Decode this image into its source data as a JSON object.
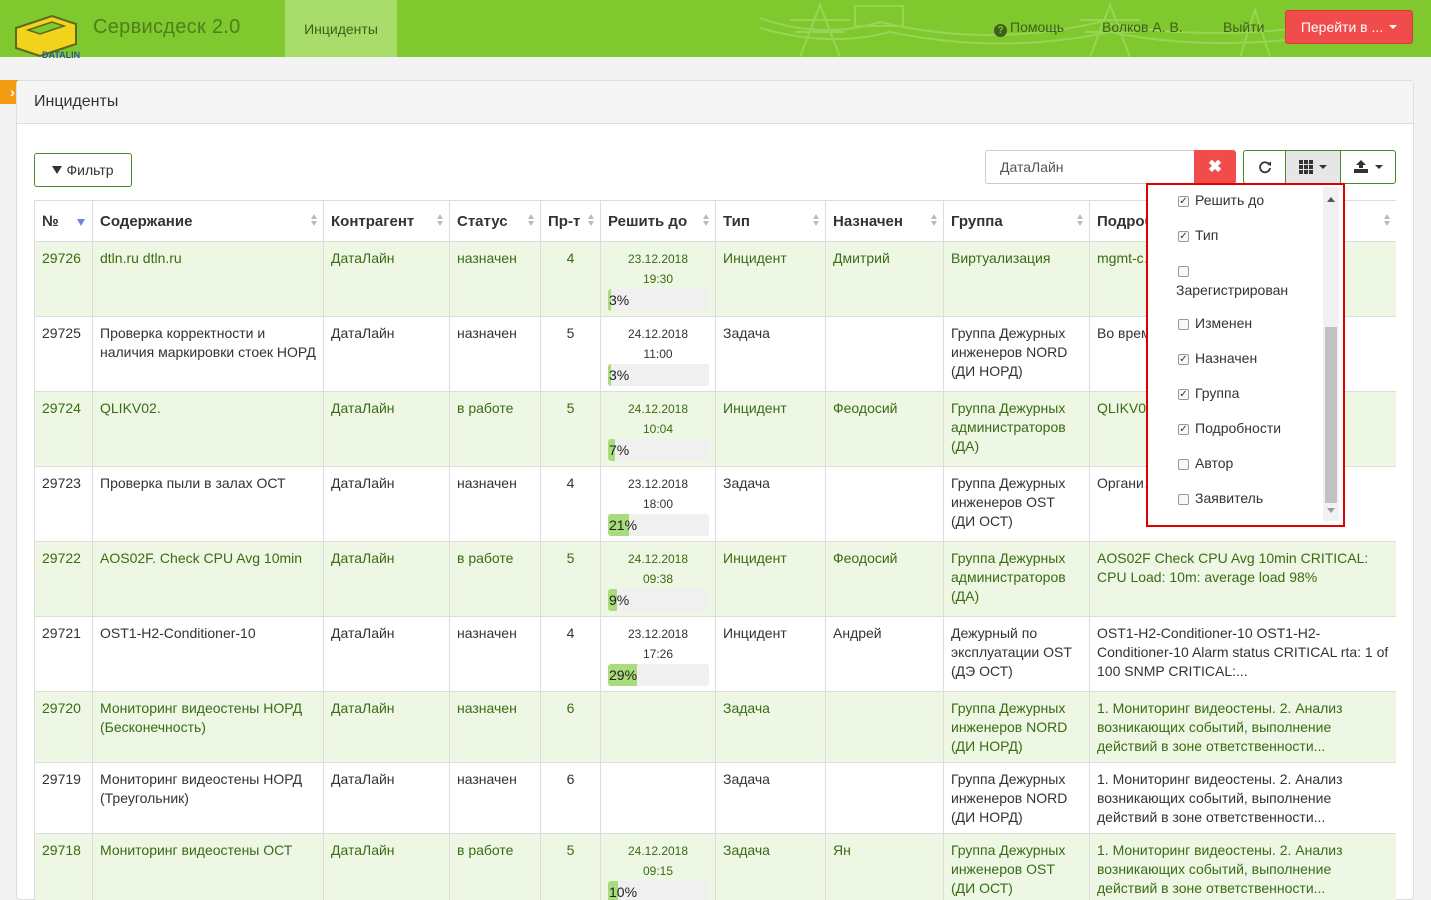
{
  "header": {
    "brand": "Сервисдеск 2.0",
    "logo_text": "DATALINE",
    "nav_active": "Инциденты",
    "help": "Помощь",
    "user": "Волков А. В.",
    "logout": "Выйти",
    "goto_button": "Перейти в ..."
  },
  "colors": {
    "navbar": "#7fc92f",
    "danger": "#f04c4c",
    "row_green": "#edf7e3",
    "progress": "#a9dc7d"
  },
  "panel": {
    "title": "Инциденты"
  },
  "toolbar": {
    "filter_label": "Фильтр",
    "search_value": "ДатаЛайн",
    "clear_icon": "times-icon",
    "refresh_icon": "refresh-icon",
    "columns_icon": "grid-icon",
    "export_icon": "export-icon"
  },
  "table": {
    "columns": [
      "№",
      "Содержание",
      "Контрагент",
      "Статус",
      "Пр-т",
      "Решить до",
      "Тип",
      "Назначен",
      "Группа",
      "Подробности"
    ],
    "rows": [
      {
        "id": "29726",
        "content": "dtln.ru dtln.ru",
        "contractor": "ДатаЛайн",
        "status": "назначен",
        "priority": "4",
        "due_date": "23.12.2018",
        "due_time": "19:30",
        "progress": "3%",
        "type": "Инцидент",
        "assigned": "Дмитрий",
        "group": "Виртуализация",
        "details": "mgmt-c… Группа… Usage …"
      },
      {
        "id": "29725",
        "content": "Проверка корректности и наличия маркировки стоек НОРД",
        "contractor": "ДатаЛайн",
        "status": "назначен",
        "priority": "5",
        "due_date": "24.12.2018",
        "due_time": "11:00",
        "progress": "3%",
        "type": "Задача",
        "assigned": "",
        "group": "Группа Дежурных инженеров NORD (ДИ НОРД)",
        "details": "Во время… провер… каждой…"
      },
      {
        "id": "29724",
        "content": "QLIKV02.",
        "contractor": "ДатаЛайн",
        "status": "в работе",
        "priority": "5",
        "due_date": "24.12.2018",
        "due_time": "10:04",
        "progress": "7%",
        "type": "Инцидент",
        "assigned": "Феодосий",
        "group": "Группа Дежурных администраторов (ДА)",
        "details": "QLIKV0… CRITICA… 99%, …"
      },
      {
        "id": "29723",
        "content": "Проверка пыли в залах ОСТ",
        "contractor": "ДатаЛайн",
        "status": "назначен",
        "priority": "4",
        "due_date": "23.12.2018",
        "due_time": "18:00",
        "progress": "21%",
        "type": "Задача",
        "assigned": "",
        "group": "Группа Дежурных инженеров OST (ДИ ОСТ)",
        "details": "Органи… всех за… грязи н…"
      },
      {
        "id": "29722",
        "content": "AOS02F. Check CPU Avg 10min",
        "contractor": "ДатаЛайн",
        "status": "в работе",
        "priority": "5",
        "due_date": "24.12.2018",
        "due_time": "09:38",
        "progress": "9%",
        "type": "Инцидент",
        "assigned": "Феодосий",
        "group": "Группа Дежурных администраторов (ДА)",
        "details": "AOS02F Check CPU Avg 10min CRITICAL: CPU Load: 10m: average load 98%"
      },
      {
        "id": "29721",
        "content": "OST1-H2-Conditioner-10",
        "contractor": "ДатаЛайн",
        "status": "назначен",
        "priority": "4",
        "due_date": "23.12.2018",
        "due_time": "17:26",
        "progress": "29%",
        "type": "Инцидент",
        "assigned": "Андрей",
        "group": "Дежурный по эксплуатации OST (ДЭ ОСТ)",
        "details": "OST1-H2-Conditioner-10 OST1-H2-Conditioner-10 Alarm status CRITICAL rta: 1 of 100 SNMP CRITICAL:..."
      },
      {
        "id": "29720",
        "content": "Мониторинг видеостены НОРД (Бесконечность)",
        "contractor": "ДатаЛайн",
        "status": "назначен",
        "priority": "6",
        "due_date": "",
        "due_time": "",
        "progress": "",
        "type": "Задача",
        "assigned": "",
        "group": "Группа Дежурных инженеров NORD (ДИ НОРД)",
        "details": "1. Мониторинг видеостены. 2. Анализ возникающих событий, выполнение действий в зоне ответственности..."
      },
      {
        "id": "29719",
        "content": "Мониторинг видеостены НОРД (Треугольник)",
        "contractor": "ДатаЛайн",
        "status": "назначен",
        "priority": "6",
        "due_date": "",
        "due_time": "",
        "progress": "",
        "type": "Задача",
        "assigned": "",
        "group": "Группа Дежурных инженеров NORD (ДИ НОРД)",
        "details": "1. Мониторинг видеостены. 2. Анализ возникающих событий, выполнение действий в зоне ответственности..."
      },
      {
        "id": "29718",
        "content": "Мониторинг видеостены ОСТ",
        "contractor": "ДатаЛайн",
        "status": "в работе",
        "priority": "5",
        "due_date": "24.12.2018",
        "due_time": "09:15",
        "progress": "10%",
        "type": "Задача",
        "assigned": "Ян",
        "group": "Группа Дежурных инженеров OST (ДИ ОСТ)",
        "details": "1. Мониторинг видеостены. 2. Анализ возникающих событий, выполнение действий в зоне ответственности..."
      }
    ]
  },
  "column_menu": {
    "options": [
      {
        "label": "Решить до",
        "checked": true
      },
      {
        "label": "Тип",
        "checked": true
      },
      {
        "label": "Зарегистрирован",
        "checked": false
      },
      {
        "label": "Изменен",
        "checked": false
      },
      {
        "label": "Назначен",
        "checked": true
      },
      {
        "label": "Группа",
        "checked": true
      },
      {
        "label": "Подробности",
        "checked": true
      },
      {
        "label": "Автор",
        "checked": false
      },
      {
        "label": "Заявитель",
        "checked": false
      }
    ]
  }
}
